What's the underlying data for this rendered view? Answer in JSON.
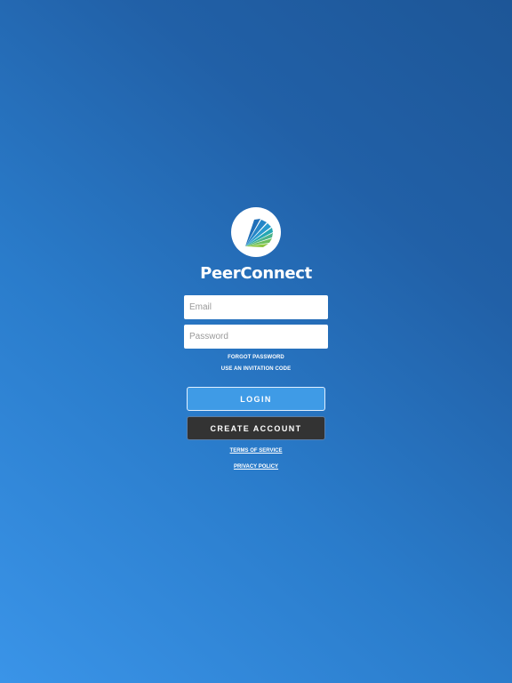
{
  "app": {
    "brand_name": "PeerConnect",
    "logo_icon": "peerconnect-fan-logo-icon",
    "colors": {
      "bg_light": "#3a94e8",
      "bg_dark": "#1d5697",
      "login_button": "#3f9be6",
      "create_button": "#333333",
      "logo_blue": "#1f7cc3",
      "logo_teal": "#25a7b4",
      "logo_green": "#8cc63f"
    }
  },
  "form": {
    "email_placeholder": "Email",
    "email_value": "",
    "password_placeholder": "Password",
    "password_value": ""
  },
  "links": {
    "forgot_password": "FORGOT PASSWORD",
    "invitation_code": "USE AN INVITATION CODE",
    "terms": "TERMS OF SERVICE",
    "privacy": "PRIVACY POLICY"
  },
  "buttons": {
    "login": "LOGIN",
    "create_account": "CREATE ACCOUNT"
  }
}
